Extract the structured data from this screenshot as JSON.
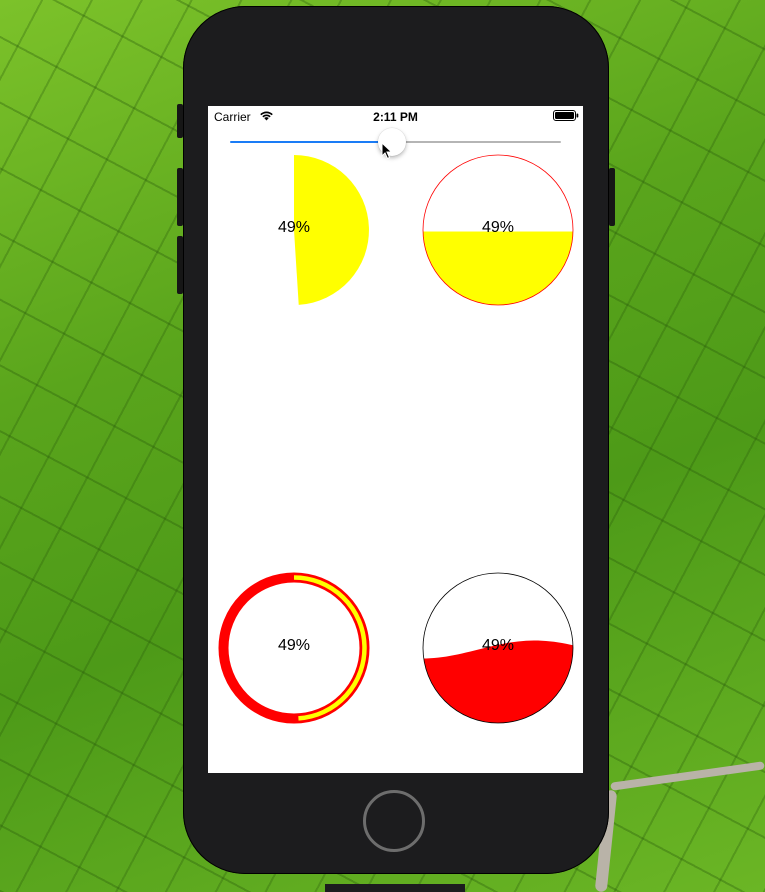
{
  "status_bar": {
    "carrier": "Carrier",
    "time": "2:11 PM",
    "wifi_icon": "wifi-icon",
    "battery_icon": "battery-icon"
  },
  "slider": {
    "value": 0.49,
    "min_color": "#1a7cf6",
    "max_color": "#b5b5b5"
  },
  "gauges": [
    {
      "id": "pie",
      "style": "half-pie",
      "value": 0.49,
      "label": "49%",
      "fill_color": "#ffff00"
    },
    {
      "id": "fill-circle",
      "style": "flat-fill",
      "value": 0.49,
      "label": "49%",
      "fill_color": "#ffff00",
      "border_color": "#ff0000"
    },
    {
      "id": "ring",
      "style": "ring",
      "value": 0.49,
      "label": "49%",
      "track_color": "#ff0000",
      "progress_color": "#ffff00"
    },
    {
      "id": "wave",
      "style": "wave-fill",
      "value": 0.49,
      "label": "49%",
      "fill_color": "#ff0000",
      "border_color": "#000000"
    }
  ],
  "colors": {
    "phone_body": "#1c1c1e",
    "screen_background": "#ffffff"
  }
}
